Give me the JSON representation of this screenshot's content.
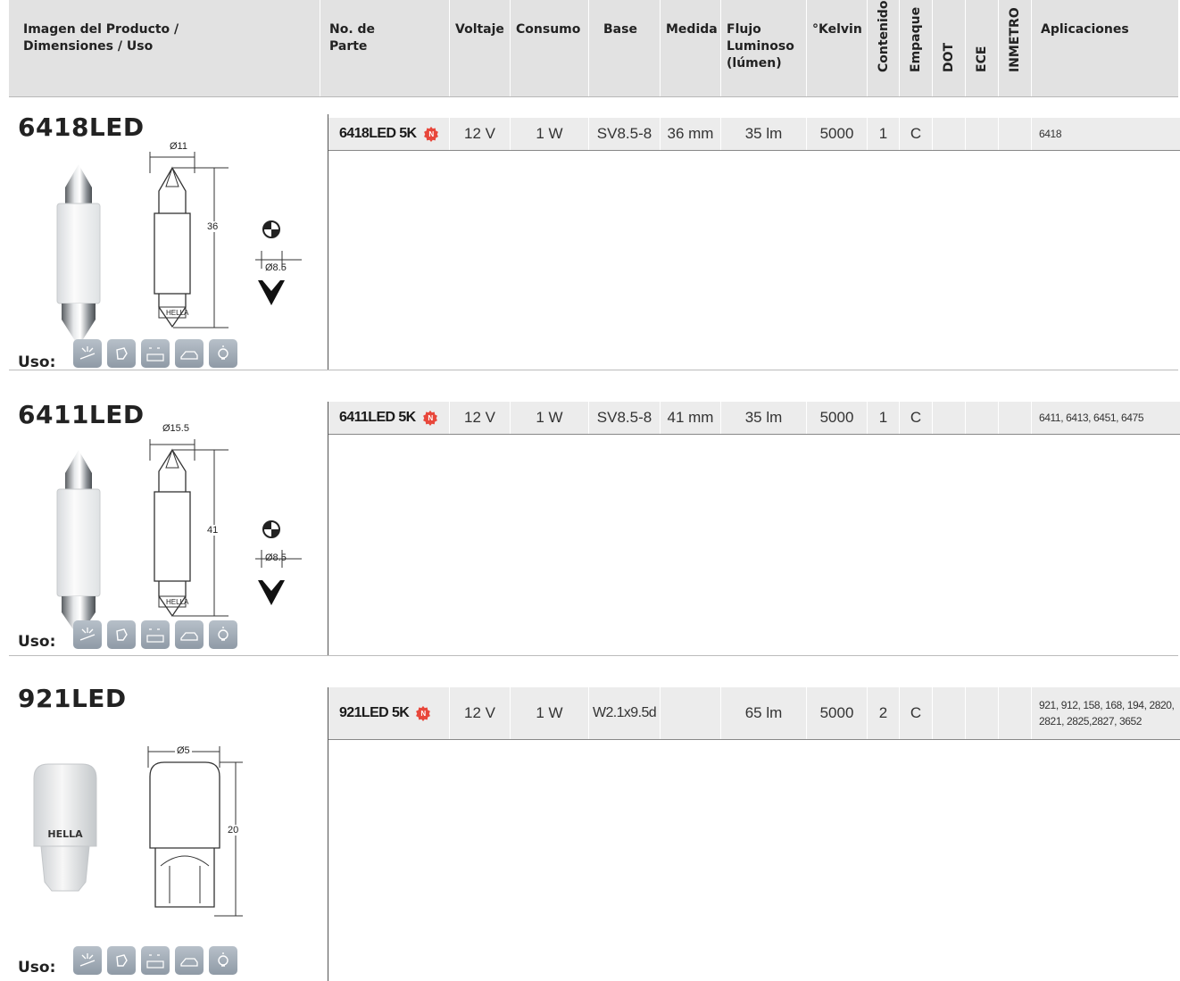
{
  "header": {
    "col_image": [
      "Imagen del Producto /",
      "Dimensiones / Uso"
    ],
    "col_part": [
      "No. de",
      "Parte"
    ],
    "col_voltage": "Voltaje",
    "col_consumption": "Consumo",
    "col_base": "Base",
    "col_size": "Medida",
    "col_flux": [
      "Flujo",
      "Luminoso",
      "(lúmen)"
    ],
    "col_kelvin": "°Kelvin",
    "col_content": "Contenido",
    "col_package": "Empaque",
    "col_dot": "DOT",
    "col_ece": "ECE",
    "col_inmetro": "INMETRO",
    "col_apps": "Aplicaciones"
  },
  "uso_label": "Uso:",
  "usage_icons": [
    "interior-light-icon",
    "map-light-icon",
    "license-plate-light-icon",
    "trunk-light-icon",
    "bulb-icon"
  ],
  "products": [
    {
      "title": "6418LED",
      "part": "6418LED 5K",
      "voltage": "12 V",
      "consumption": "1 W",
      "base": "SV8.5-8",
      "size": "36 mm",
      "flux": "35 lm",
      "kelvin": "5000",
      "content": "1",
      "package": "C",
      "dot": "",
      "ece": "",
      "inmetro": "",
      "apps": [
        "6418"
      ],
      "dims": {
        "width": "Ø11",
        "length": "36",
        "base_d": "Ø8.5",
        "brand": "HELLA"
      }
    },
    {
      "title": "6411LED",
      "part": "6411LED 5K",
      "voltage": "12 V",
      "consumption": "1 W",
      "base": "SV8.5-8",
      "size": "41 mm",
      "flux": "35 lm",
      "kelvin": "5000",
      "content": "1",
      "package": "C",
      "dot": "",
      "ece": "",
      "inmetro": "",
      "apps": [
        "6411, 6413, 6451, 6475"
      ],
      "dims": {
        "width": "Ø15.5",
        "length": "41",
        "base_d": "Ø8.5",
        "brand": "HELLA"
      }
    },
    {
      "title": "921LED",
      "part": "921LED 5K",
      "voltage": "12 V",
      "consumption": "1 W",
      "base": "W2.1x9.5d",
      "size": "",
      "flux": "65 lm",
      "kelvin": "5000",
      "content": "2",
      "package": "C",
      "dot": "",
      "ece": "",
      "inmetro": "",
      "apps": [
        "921, 912, 158, 168, 194, 2820,",
        "2821, 2825,2827, 3652"
      ],
      "dims": {
        "width": "Ø5",
        "length": "20",
        "brand": "HELLA"
      }
    }
  ],
  "colors": {
    "header_bg": "#e2e2e2",
    "row_bg": "#ececec",
    "badge": "#e8473b",
    "icon_bg": "#9ba6b1"
  }
}
